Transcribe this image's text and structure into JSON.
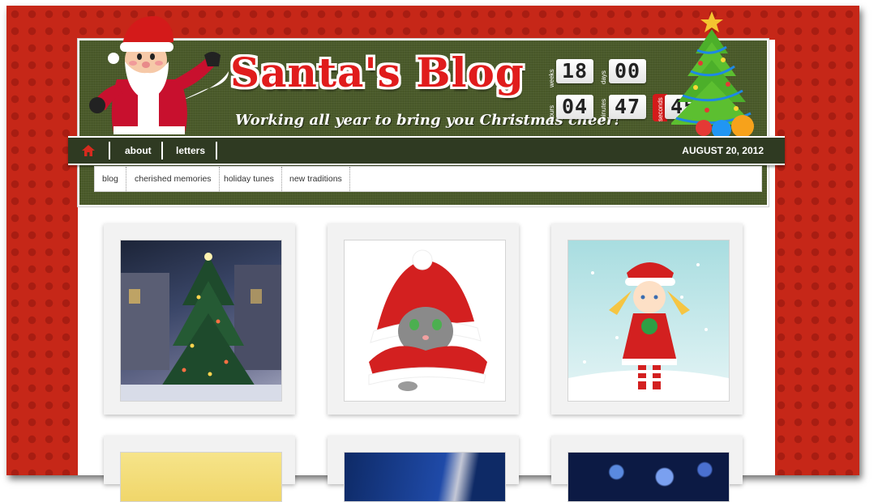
{
  "blog": {
    "title": "Santa's Blog",
    "tagline": "Working all year to bring you Christmas cheer!"
  },
  "countdown": {
    "weeks": {
      "label": "weeks",
      "value": "18"
    },
    "days": {
      "label": "days",
      "value": "00"
    },
    "hours": {
      "label": "hours",
      "value": "04"
    },
    "minutes": {
      "label": "minutes",
      "value": "47"
    },
    "seconds": {
      "label": "seconds",
      "value": "45"
    }
  },
  "nav": {
    "home_icon": "home-icon",
    "items": [
      {
        "label": "about"
      },
      {
        "label": "letters"
      }
    ],
    "date": "AUGUST 20, 2012"
  },
  "subnav": {
    "items": [
      {
        "label": "blog"
      },
      {
        "label": "cherished memories"
      },
      {
        "label": "holiday tunes"
      },
      {
        "label": "new traditions"
      }
    ]
  },
  "colors": {
    "background_red": "#c62718",
    "header_green": "#4a5a2a",
    "nav_dark": "#2f3a22",
    "title_red": "#e01c1c"
  }
}
